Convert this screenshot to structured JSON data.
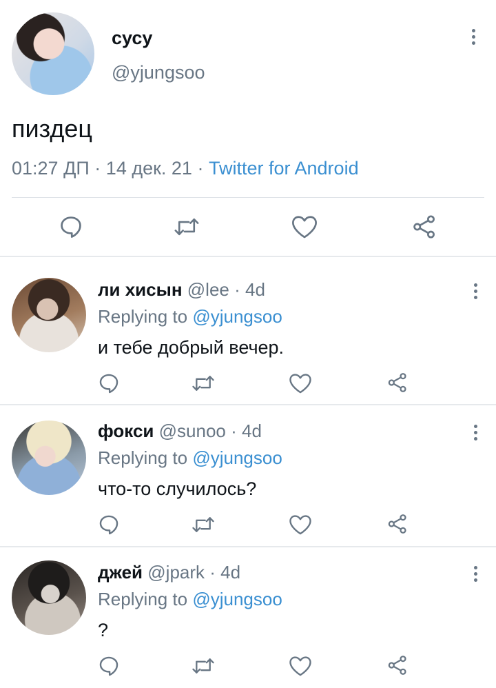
{
  "main_tweet": {
    "display_name": "сусу",
    "handle": "@yjungsoo",
    "text": "пиздец",
    "time": "01:27 ДП",
    "date": "14 дек. 21",
    "separator": "·",
    "source": "Twitter for Android"
  },
  "icons": {
    "reply": "speech-bubble-icon",
    "retweet": "retweet-icon",
    "like": "heart-icon",
    "share": "share-icon",
    "menu": "vertical-dots-icon"
  },
  "colors": {
    "text": "#0f1419",
    "secondary": "#687684",
    "link": "#3a8fd1",
    "divider": "#e6e9ec"
  },
  "replies": [
    {
      "display_name": "ли хисын",
      "handle": "@lee",
      "age": "4d",
      "replying_label": "Replying to",
      "replying_to": "@yjungsoo",
      "text": "и тебе добрый вечер."
    },
    {
      "display_name": "фокси",
      "handle": "@sunoo",
      "age": "4d",
      "replying_label": "Replying to",
      "replying_to": "@yjungsoo",
      "text": "что-то случилось?"
    },
    {
      "display_name": "джей",
      "handle": "@jpark",
      "age": "4d",
      "replying_label": "Replying to",
      "replying_to": "@yjungsoo",
      "text": "?"
    }
  ]
}
